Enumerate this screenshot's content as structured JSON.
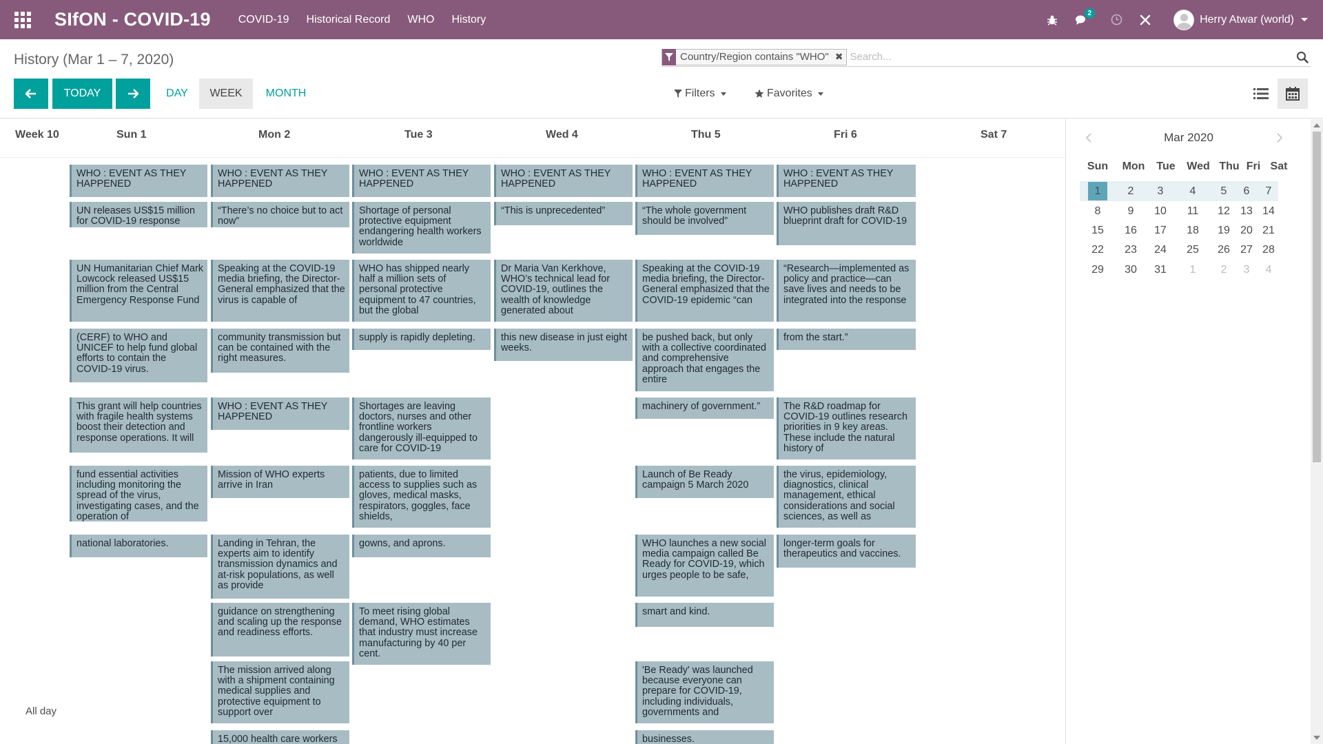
{
  "navbar": {
    "brand": "SIfON - COVID-19",
    "menu": [
      "COVID-19",
      "Historical Record",
      "WHO",
      "History"
    ],
    "messages_badge": "2",
    "user_name": "Herry Atwar (world)",
    "bg_color": "#875a7b"
  },
  "control_panel": {
    "title": "History (Mar 1 – 7, 2020)",
    "search": {
      "facet": "Country/Region contains \"WHO\"",
      "placeholder": "Search..."
    },
    "today_label": "TODAY",
    "scale_day": "DAY",
    "scale_week": "WEEK",
    "scale_month": "MONTH",
    "filters_label": "Filters",
    "favorites_label": "Favorites",
    "accent_color": "#00a09d"
  },
  "calendar": {
    "week_label": "Week 10",
    "days": [
      "Sun 1",
      "Mon 2",
      "Tue 3",
      "Wed 4",
      "Thu 5",
      "Fri 6",
      "Sat 7"
    ],
    "allday_label": "All day",
    "events": {
      "sun": [
        "WHO : EVENT AS THEY HAPPENED",
        "UN releases US$15 million for COVID-19 response",
        "UN Humanitarian Chief Mark Lowcock released US$15 million from the Central Emergency Response Fund",
        "(CERF) to WHO and UNICEF to help fund global efforts to contain the COVID-19 virus.",
        "This grant will help countries with fragile health systems boost their detection and response operations. It will",
        "fund essential activities including monitoring the spread of the virus, investigating cases, and the operation of",
        "national laboratories."
      ],
      "mon": [
        "WHO : EVENT AS THEY HAPPENED",
        "“There’s no choice but to act now”",
        "Speaking at the COVID-19 media briefing, the Director-General emphasized that the virus is capable of",
        "community transmission but can be contained with the right measures.",
        "WHO : EVENT AS THEY HAPPENED",
        "Mission of WHO experts arrive in Iran",
        "Landing in Tehran, the experts aim to identify transmission dynamics and at-risk populations, as well as provide",
        "guidance on strengthening and scaling up the response and readiness efforts.",
        "The mission arrived along with a shipment containing medical supplies and protective equipment to support over",
        "15,000 health care workers"
      ],
      "tue": [
        "WHO : EVENT AS THEY HAPPENED",
        "Shortage of personal protective equipment endangering health workers worldwide",
        "WHO has shipped nearly half a million sets of personal protective equipment to 47 countries, but the global",
        "supply is rapidly depleting.",
        "Shortages are leaving doctors, nurses and other frontline workers dangerously ill-equipped to care for COVID-19",
        "patients, due to limited access to supplies such as gloves, medical masks, respirators, goggles, face shields,",
        "gowns, and aprons.",
        "To meet rising global demand, WHO estimates that industry must increase manufacturing by 40 per cent."
      ],
      "wed": [
        "WHO : EVENT AS THEY HAPPENED",
        "“This is unprecedented”",
        "Dr Maria Van Kerkhove, WHO’s technical lead for COVID-19, outlines the wealth of knowledge generated about",
        "this new disease in just eight weeks."
      ],
      "thu": [
        "WHO : EVENT AS THEY HAPPENED",
        "“The whole government should be involved”",
        "Speaking at the COVID-19 media briefing, the Director-General emphasized that the COVID-19 epidemic “can",
        "be pushed back, but only with a collective coordinated and comprehensive approach that engages the entire",
        "machinery of government.”",
        "Launch of Be Ready campaign 5 March 2020",
        "WHO launches a new social media campaign called Be Ready for COVID-19, which urges people to be safe,",
        "smart and kind.",
        "'Be Ready' was launched because everyone can prepare for COVID-19, including individuals, governments and",
        "businesses."
      ],
      "fri": [
        "WHO : EVENT AS THEY HAPPENED",
        "WHO publishes draft R&D blueprint draft for COVID-19",
        "“Research—implemented as policy and practice—can save lives and needs to be integrated into the response",
        "from the start.”",
        "The R&D roadmap for COVID-19 outlines research priorities in 9 key areas. These include the natural history of",
        "the virus, epidemiology, diagnostics, clinical management, ethical considerations and social sciences, as well as",
        "longer-term goals for therapeutics and vaccines."
      ]
    }
  },
  "mini_calendar": {
    "title": "Mar 2020",
    "dow": [
      "Sun",
      "Mon",
      "Tue",
      "Wed",
      "Thu",
      "Fri",
      "Sat"
    ],
    "weeks": [
      [
        "1",
        "2",
        "3",
        "4",
        "5",
        "6",
        "7"
      ],
      [
        "8",
        "9",
        "10",
        "11",
        "12",
        "13",
        "14"
      ],
      [
        "15",
        "16",
        "17",
        "18",
        "19",
        "20",
        "21"
      ],
      [
        "22",
        "23",
        "24",
        "25",
        "26",
        "27",
        "28"
      ],
      [
        "29",
        "30",
        "31",
        "1",
        "2",
        "3",
        "4"
      ]
    ],
    "selected_day": "1"
  }
}
